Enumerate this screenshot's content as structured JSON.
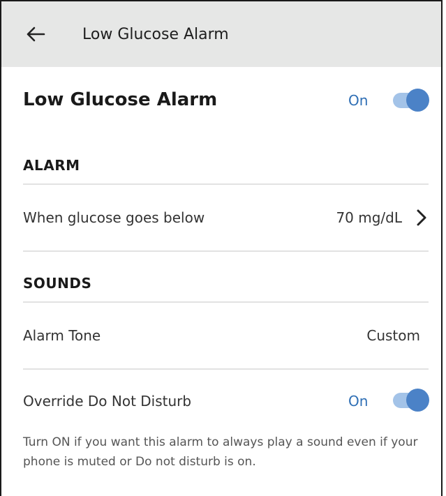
{
  "appbar": {
    "title": "Low Glucose Alarm",
    "back_icon": "arrow-left-icon"
  },
  "hero": {
    "title": "Low Glucose Alarm",
    "state": "On",
    "enabled": true
  },
  "alarm_section": {
    "title": "ALARM",
    "threshold_label": "When glucose goes below",
    "threshold_value": "70 mg/dL",
    "chevron_icon": "chevron-right-icon"
  },
  "sounds_section": {
    "title": "SOUNDS",
    "tone_label": "Alarm Tone",
    "tone_value": "Custom",
    "dnd_label": "Override Do Not Disturb",
    "dnd_state": "On",
    "dnd_enabled": true,
    "help_text": "Turn ON if you want this alarm to always play a sound even if your phone is muted or Do not disturb is on."
  },
  "colors": {
    "accent": "#4b82c7",
    "accent_light": "#a3c3e8",
    "state_text": "#2f6fb5",
    "appbar_bg": "#e6e7e6"
  }
}
